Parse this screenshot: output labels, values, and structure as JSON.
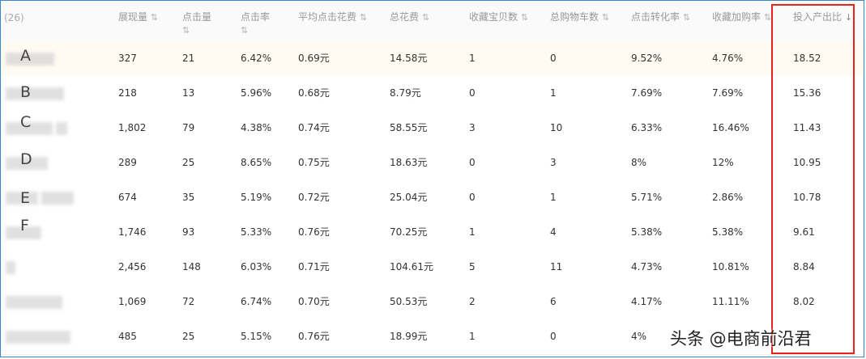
{
  "header": {
    "count": "(26)",
    "columns": [
      {
        "key": "impressions",
        "label": "展现量",
        "sort_icon": "⇅"
      },
      {
        "key": "clicks",
        "label": "点击量",
        "sort_icon": "⇅"
      },
      {
        "key": "ctr",
        "label": "点击率",
        "sort_icon": "⇅"
      },
      {
        "key": "cpc",
        "label": "平均点击花费",
        "sort_icon": "⇅"
      },
      {
        "key": "cost",
        "label": "总花费",
        "sort_icon": "⇅"
      },
      {
        "key": "favorites",
        "label": "收藏宝贝数",
        "sort_icon": "⇅"
      },
      {
        "key": "cart",
        "label": "总购物车数",
        "sort_icon": "⇅"
      },
      {
        "key": "cvr",
        "label": "点击转化率",
        "sort_icon": "⇅"
      },
      {
        "key": "fav_cart_rate",
        "label": "收藏加购率",
        "sort_icon": "⇅"
      },
      {
        "key": "roi",
        "label": "投入产出比",
        "sort_icon": "↓"
      }
    ]
  },
  "rows": [
    {
      "label": "A",
      "values": [
        "327",
        "21",
        "6.42%",
        "0.69元",
        "14.58元",
        "1",
        "0",
        "9.52%",
        "4.76%",
        "18.52"
      ]
    },
    {
      "label": "B",
      "values": [
        "218",
        "13",
        "5.96%",
        "0.68元",
        "8.79元",
        "0",
        "1",
        "7.69%",
        "7.69%",
        "15.36"
      ]
    },
    {
      "label": "C",
      "values": [
        "1,802",
        "79",
        "4.38%",
        "0.74元",
        "58.55元",
        "3",
        "10",
        "6.33%",
        "16.46%",
        "11.43"
      ]
    },
    {
      "label": "D",
      "values": [
        "289",
        "25",
        "8.65%",
        "0.75元",
        "18.63元",
        "0",
        "3",
        "8%",
        "12%",
        "10.95"
      ]
    },
    {
      "label": "E",
      "values": [
        "674",
        "35",
        "5.19%",
        "0.72元",
        "25.04元",
        "0",
        "1",
        "5.71%",
        "2.86%",
        "10.78"
      ]
    },
    {
      "label": "F",
      "values": [
        "1,746",
        "93",
        "5.33%",
        "0.76元",
        "70.25元",
        "1",
        "4",
        "5.38%",
        "5.38%",
        "9.61"
      ]
    },
    {
      "label": "",
      "values": [
        "2,456",
        "148",
        "6.03%",
        "0.71元",
        "104.61元",
        "5",
        "11",
        "4.73%",
        "10.81%",
        "8.84"
      ]
    },
    {
      "label": "",
      "values": [
        "1,069",
        "72",
        "6.74%",
        "0.70元",
        "50.53元",
        "2",
        "6",
        "4.17%",
        "11.11%",
        "8.02"
      ]
    },
    {
      "label": "",
      "values": [
        "485",
        "25",
        "5.15%",
        "0.76元",
        "18.99元",
        "1",
        "0",
        "4%",
        "",
        ""
      ]
    }
  ],
  "watermark": "头条 @电商前沿君",
  "colors": {
    "highlight_box": "#e8231e",
    "highlighted_row": "#fffbf3",
    "header_bg": "#fafafa",
    "frame_border": "#3a86c8"
  }
}
